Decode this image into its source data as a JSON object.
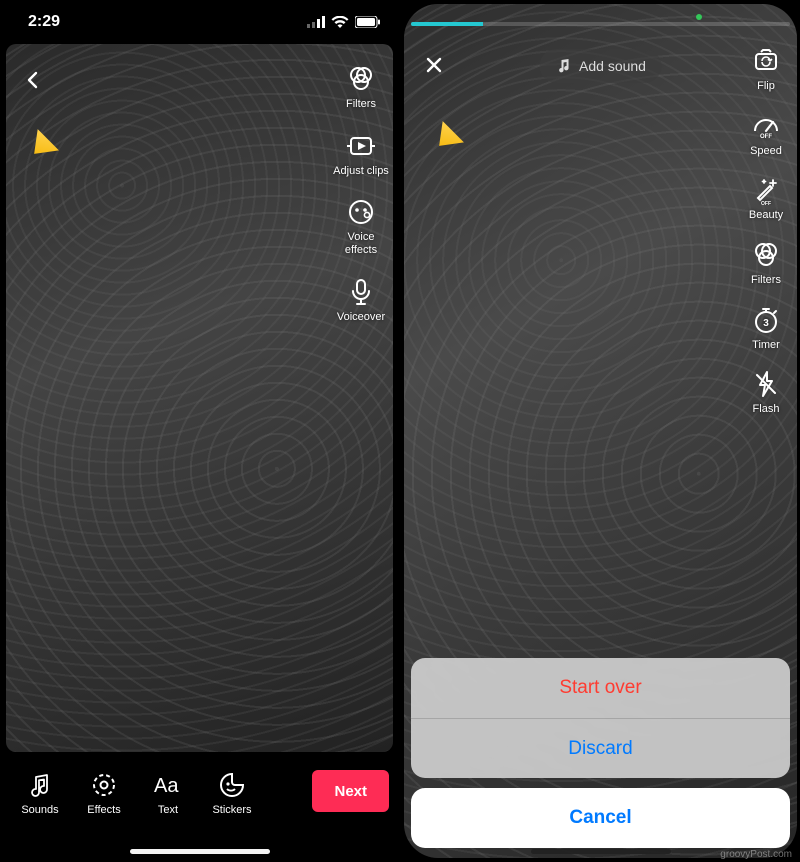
{
  "left": {
    "status": {
      "time": "2:29"
    },
    "tools": {
      "filters": "Filters",
      "adjust_clips": "Adjust clips",
      "voice_effects": "Voice\neffects",
      "voiceover": "Voiceover"
    },
    "nav": {
      "sounds": "Sounds",
      "effects": "Effects",
      "text": "Text",
      "stickers": "Stickers",
      "next": "Next"
    }
  },
  "right": {
    "add_sound": "Add sound",
    "tools": {
      "flip": "Flip",
      "speed": "Speed",
      "beauty": "Beauty",
      "filters": "Filters",
      "timer": "Timer",
      "flash": "Flash"
    },
    "sheet": {
      "start_over": "Start over",
      "discard": "Discard",
      "cancel": "Cancel"
    }
  },
  "watermark": "groovyPost.com"
}
